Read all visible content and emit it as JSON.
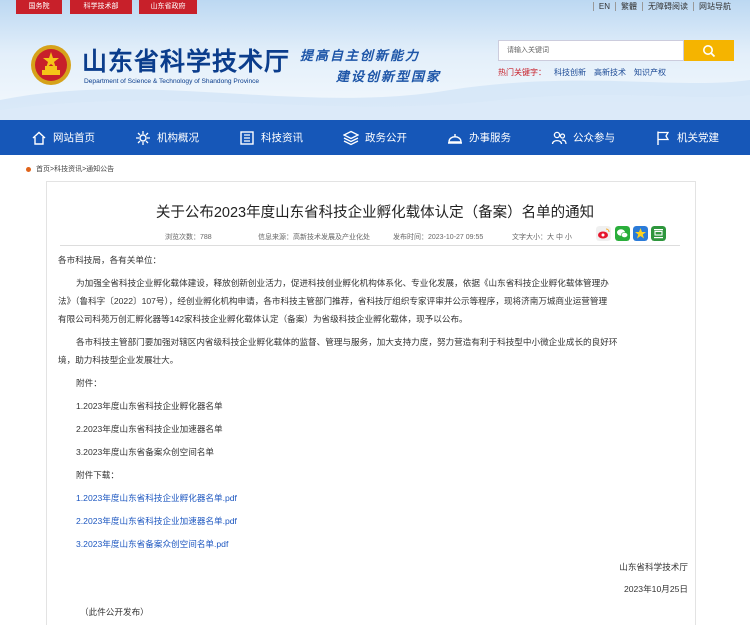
{
  "topbar": {
    "links": [
      "国务院",
      "科学技术部",
      "山东省政府"
    ],
    "right": [
      "EN",
      "繁體",
      "无障碍阅读",
      "网站导航"
    ]
  },
  "header": {
    "title": "山东省科学技术厅",
    "subtitle": "Department of Science & Technology of Shandong Province",
    "slogan_line1": "提高自主创新能力",
    "slogan_line2": "建设创新型国家",
    "search_placeholder": "请输入关键词",
    "hot_label": "热门关键字：",
    "hot_words": [
      "科技创新",
      "高新技术",
      "知识产权"
    ]
  },
  "nav": {
    "items": [
      {
        "label": "网站首页",
        "icon": "home-icon"
      },
      {
        "label": "机构概况",
        "icon": "org-icon"
      },
      {
        "label": "科技资讯",
        "icon": "news-icon"
      },
      {
        "label": "政务公开",
        "icon": "layers-icon"
      },
      {
        "label": "办事服务",
        "icon": "service-icon"
      },
      {
        "label": "公众参与",
        "icon": "people-icon"
      },
      {
        "label": "机关党建",
        "icon": "flag-icon"
      }
    ]
  },
  "breadcrumb": "首页>科技资讯>通知公告",
  "article": {
    "title": "关于公布2023年度山东省科技企业孵化载体认定（备案）名单的通知",
    "views_label": "浏览次数：",
    "views": "788",
    "source_label": "信息来源：",
    "source": "高新技术发展及产业化处",
    "date_label": "发布时间：",
    "date": "2023-10-27 09:55",
    "fontsize_label": "文字大小：",
    "fontsize_options": "大 中 小",
    "greeting": "各市科技局，各有关单位：",
    "para1_line1": "为加强全省科技企业孵化载体建设，释放创新创业活力，促进科技创业孵化机构体系化、专业化发展，依据《山东省科技企业孵化载体管理办",
    "para1_line2": "法》（鲁科字〔2022〕107号），经创业孵化机构申请，各市科技主管部门推荐，省科技厅组织专家评审并公示等程序，现将济南万城商业运营管理",
    "para1_line3": "有限公司科苑万创汇孵化器等142家科技企业孵化载体认定（备案）为省级科技企业孵化载体，现予以公布。",
    "para2_line1": "各市科技主管部门要加强对辖区内省级科技企业孵化载体的监督、管理与服务，加大支持力度，努力营造有利于科技型中小微企业成长的良好环",
    "para2_line2": "境，助力科技型企业发展壮大。",
    "attachments_label": "附件：",
    "attachments": [
      "1.2023年度山东省科技企业孵化器名单",
      "2.2023年度山东省科技企业加速器名单",
      "3.2023年度山东省备案众创空间名单"
    ],
    "downloads_label": "附件下载：",
    "downloads": [
      "1.2023年度山东省科技企业孵化器名单.pdf",
      "2.2023年度山东省科技企业加速器名单.pdf",
      "3.2023年度山东省备案众创空间名单.pdf"
    ],
    "signature": "山东省科学技术厅",
    "sign_date": "2023年10月25日",
    "footnote": "（此件公开发布）"
  },
  "colors": {
    "nav_bg": "#1657b8",
    "brand_red": "#c8202a",
    "link": "#1d57c0",
    "title_blue": "#0b3d8c",
    "search_btn": "#f5b400"
  }
}
